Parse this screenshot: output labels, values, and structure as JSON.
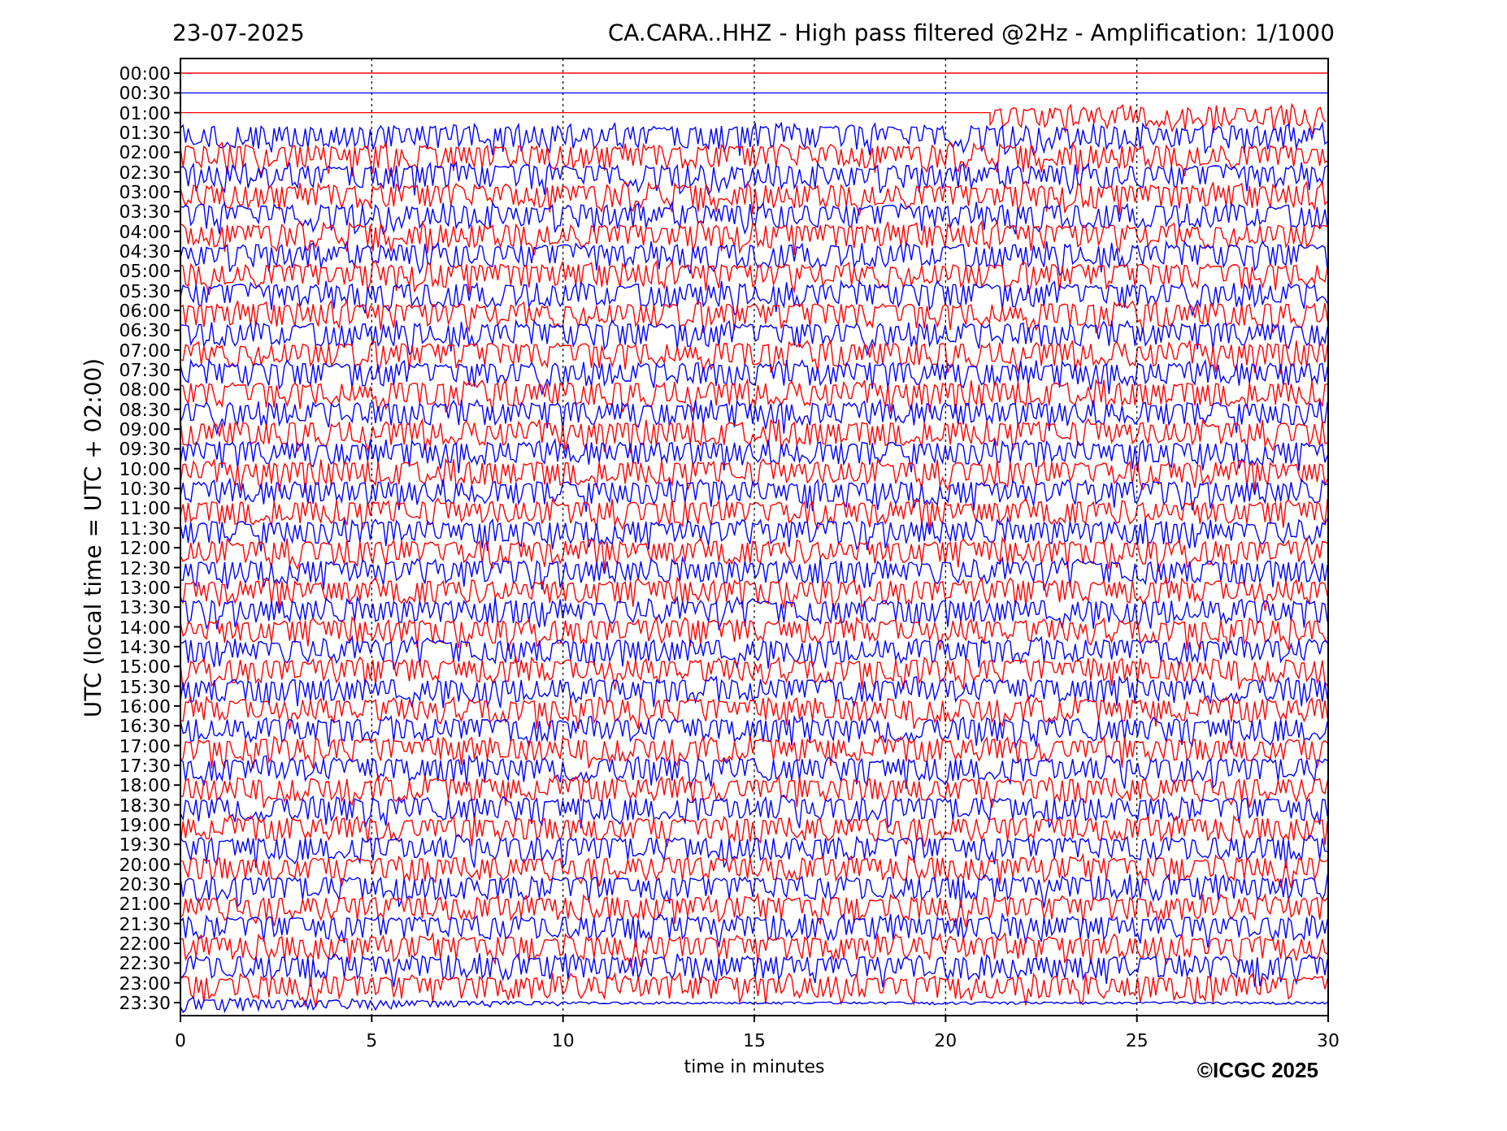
{
  "header": {
    "date": "23-07-2025",
    "title": "CA.CARA..HHZ - High pass filtered @2Hz - Amplification: 1/1000"
  },
  "y_axis": {
    "label": "UTC (local time = UTC + 02:00)",
    "ticks": [
      "00:00",
      "00:30",
      "01:00",
      "01:30",
      "02:00",
      "02:30",
      "03:00",
      "03:30",
      "04:00",
      "04:30",
      "05:00",
      "05:30",
      "06:00",
      "06:30",
      "07:00",
      "07:30",
      "08:00",
      "08:30",
      "09:00",
      "09:30",
      "10:00",
      "10:30",
      "11:00",
      "11:30",
      "12:00",
      "12:30",
      "13:00",
      "13:30",
      "14:00",
      "14:30",
      "15:00",
      "15:30",
      "16:00",
      "16:30",
      "17:00",
      "17:30",
      "18:00",
      "18:30",
      "19:00",
      "19:30",
      "20:00",
      "20:30",
      "21:00",
      "21:30",
      "22:00",
      "22:30",
      "23:00",
      "23:30"
    ]
  },
  "x_axis": {
    "label": "time in minutes",
    "ticks": [
      "0",
      "5",
      "10",
      "15",
      "20",
      "25",
      "30"
    ]
  },
  "copyright": "©ICGC 2025"
}
